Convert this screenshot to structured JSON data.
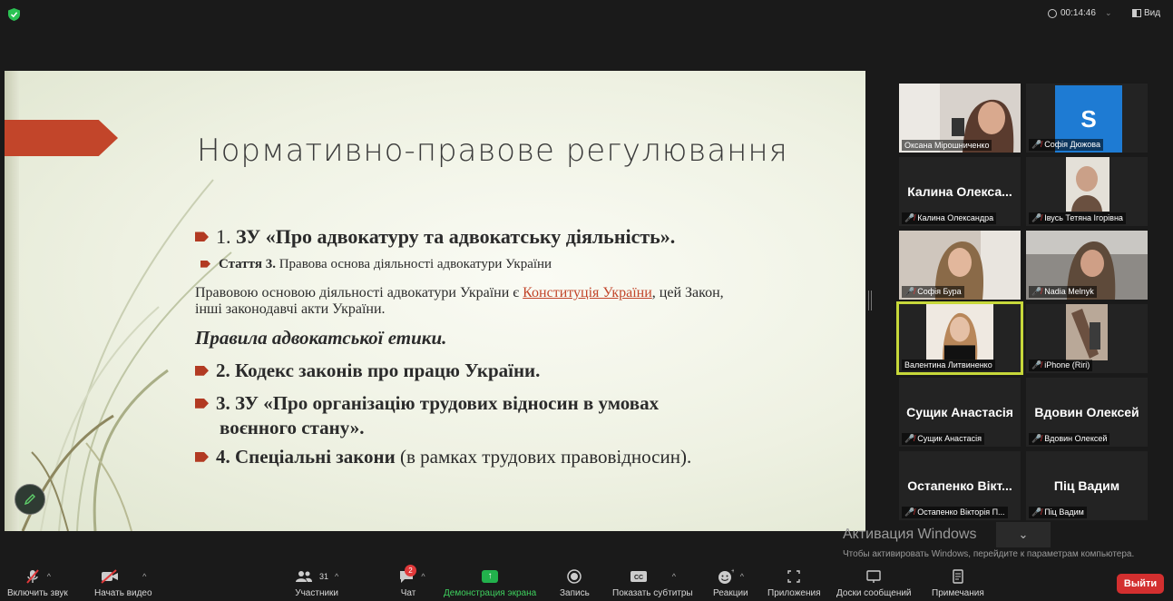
{
  "top_bar": {
    "timer": "00:14:46",
    "view_label": "Вид"
  },
  "slide": {
    "title": "Нормативно-правове регулювання",
    "item1_num": "1.",
    "item1_text": "ЗУ «Про адвокатуру та адвокатську діяльність».",
    "article_bold": "Стаття 3.",
    "article_text": "Правова основа діяльності адвокатури України",
    "para_before": "Правовою основою діяльності адвокатури України є",
    "para_link": "Конституція України",
    "para_after": ", цей Закон,",
    "para_line2": "інші законодавчі акти України.",
    "ethics": "Правила адвокатської етики.",
    "item2": "2. Кодекс законів про працю України.",
    "item3_line1": "3. ЗУ «Про організацію трудових відносин в умовах",
    "item3_line2": "воєнного стану».",
    "item4_bold": "4. Спеціальні закони",
    "item4_rest": "(в рамках трудових правовідносин)."
  },
  "participants": [
    {
      "label": "Оксана Мірошниченко"
    },
    {
      "label": "Софія Дюжова",
      "avatar": "S"
    },
    {
      "big": "Калина Олекса...",
      "label": "Калина Олександра"
    },
    {
      "label": "Івусь Тетяна Ігорівна"
    },
    {
      "label": "Софія Бура"
    },
    {
      "label": "Nadia Melnyk"
    },
    {
      "label": "Валентина Литвиненко"
    },
    {
      "label": "iPhone (Riri)"
    },
    {
      "big": "Сущик Анастасія",
      "label": "Сущик Анастасія"
    },
    {
      "big": "Вдовин Олексей",
      "label": "Вдовин Олексей"
    },
    {
      "big": "Остапенко Вікт...",
      "label": "Остапенко Вікторія П..."
    },
    {
      "big": "Піц Вадим",
      "label": "Піц Вадим"
    }
  ],
  "watermark": {
    "title": "Активация Windows",
    "text": "Чтобы активировать Windows, перейдите к параметрам компьютера."
  },
  "toolbar": {
    "audio": "Включить звук",
    "video": "Начать видео",
    "participants": "Участники",
    "participants_count": "31",
    "chat": "Чат",
    "chat_badge": "2",
    "share": "Демонстрация экрана",
    "record": "Запись",
    "captions": "Показать субтитры",
    "reactions": "Реакции",
    "apps": "Приложения",
    "whiteboards": "Доски сообщений",
    "notes": "Примечания",
    "leave": "Выйти"
  },
  "colors": {
    "accent_green": "#22b14c",
    "leave_red": "#d32f2f",
    "active_speaker": "#c7d83a",
    "slide_accent": "#c2452a"
  }
}
